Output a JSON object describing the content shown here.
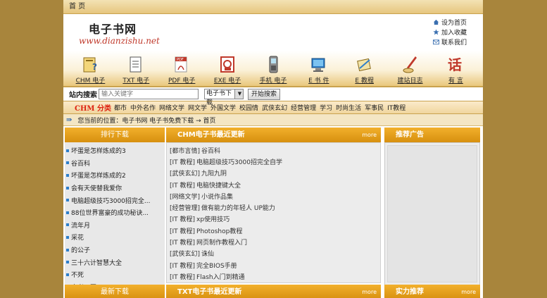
{
  "topbar": {
    "home_label": "首 页"
  },
  "logo": {
    "cn": "电子书网",
    "en": "www.dianzishu.net"
  },
  "header_links": [
    {
      "label": "设为首页",
      "icon": "home-icon"
    },
    {
      "label": "加入收藏",
      "icon": "star-icon"
    },
    {
      "label": "联系我们",
      "icon": "mail-icon"
    }
  ],
  "nav": [
    {
      "label": "CHM 电子",
      "icon": "chm-icon"
    },
    {
      "label": "TXT 电子",
      "icon": "txt-icon"
    },
    {
      "label": "PDF 电子",
      "icon": "pdf-icon"
    },
    {
      "label": "EXE 电子",
      "icon": "exe-icon"
    },
    {
      "label": "手机 电子",
      "icon": "phone-icon"
    },
    {
      "label": "E 书 件",
      "icon": "software-icon"
    },
    {
      "label": "E 教程",
      "icon": "tutorial-icon"
    },
    {
      "label": "建站日志",
      "icon": "blog-icon"
    },
    {
      "label": "有 言",
      "icon": "message-icon"
    }
  ],
  "search": {
    "label": "站内搜索",
    "placeholder": "输入关键字",
    "selected_option": "电子书下载",
    "button_label": "开始搜索"
  },
  "categories": {
    "title": "CHM 分类",
    "items": [
      "都市",
      "中外名作",
      "网络文学",
      "网文学",
      "外国文学",
      "校园情",
      "武侠玄幻",
      "经营管理",
      "学习",
      "时尚生活",
      "军事民",
      "IT教程"
    ]
  },
  "location": {
    "text": "您当前的位置：电子书网 电子书免费下载 → 首页"
  },
  "left_panel": {
    "title": "排行下载",
    "items": [
      "坏蛋是怎样炼成的3",
      "谷百科",
      "坏蛋是怎样炼成的2",
      "会有天使替我爱你",
      "电脑超级技巧3000招完全...",
      "88位世界富豪的成功秘诀...",
      "流年月",
      "采花",
      "的公子",
      "三十六计智慧大全",
      "不死",
      "水煮三国"
    ]
  },
  "main_panel": {
    "title": "CHM电子书最近更新",
    "more": "more",
    "items": [
      {
        "cat": "[都市言情]",
        "title": "谷百科"
      },
      {
        "cat": "[IT 教程]",
        "title": "电脑超级技巧3000招完全自学"
      },
      {
        "cat": "[武侠玄幻]",
        "title": "九阳九阴"
      },
      {
        "cat": "[IT 教程]",
        "title": "电脑快捷键大全"
      },
      {
        "cat": "[网络文学]",
        "title": "小说作品集"
      },
      {
        "cat": "[经营管理]",
        "title": "做有能力的年轻人 UP能力"
      },
      {
        "cat": "[IT 教程]",
        "title": "xp使用技巧"
      },
      {
        "cat": "[IT 教程]",
        "title": "Photoshop教程"
      },
      {
        "cat": "[IT 教程]",
        "title": "网页制作教程入门"
      },
      {
        "cat": "[武侠玄幻]",
        "title": "诛仙"
      },
      {
        "cat": "[IT 教程]",
        "title": "完全BIOS手册"
      },
      {
        "cat": "[IT 教程]",
        "title": "Flash入门到精通"
      }
    ]
  },
  "right_panel": {
    "title": "推荐广告"
  },
  "bottom": {
    "left_title": "最新下载",
    "mid_title": "TXT电子书最近更新",
    "mid_more": "more",
    "right_title": "实力推荐",
    "right_more": "more"
  },
  "colors": {
    "background": "#a8853c",
    "accent": "#e4a11b",
    "category_title": "#dd2211",
    "link_bullet": "#2f7fc9"
  }
}
